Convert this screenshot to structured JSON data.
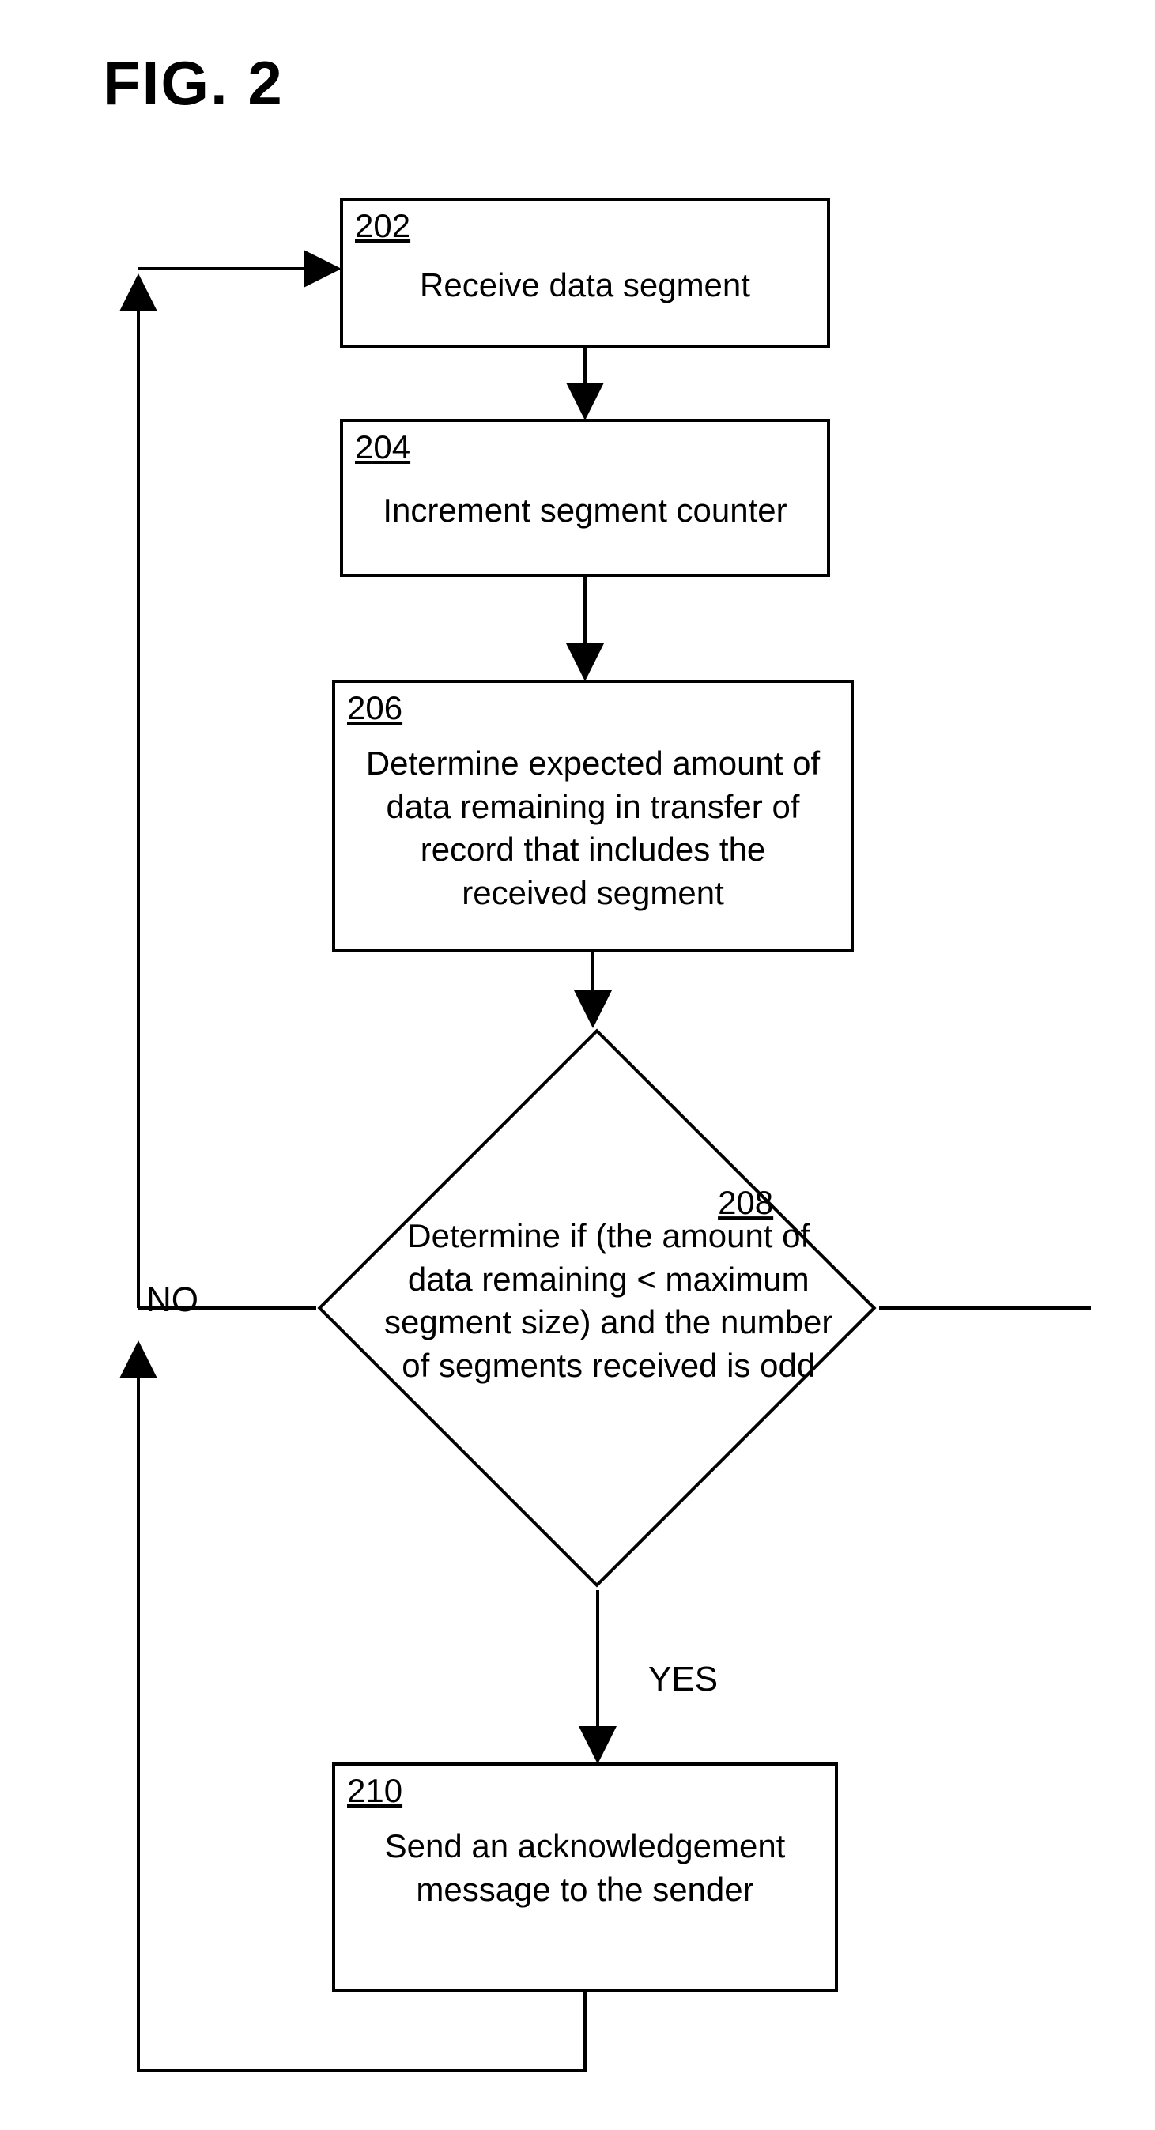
{
  "title": "FIG. 2",
  "nodes": {
    "n202": {
      "num": "202",
      "text": "Receive data segment"
    },
    "n204": {
      "num": "204",
      "text": "Increment segment counter"
    },
    "n206": {
      "num": "206",
      "text": "Determine expected amount of data remaining in transfer of record that includes the received segment"
    },
    "n208": {
      "num": "208",
      "text": "Determine if (the amount of data remaining <  maximum segment size) and  the number of segments received is odd"
    },
    "n210": {
      "num": "210",
      "text": "Send an acknowledgement message to the sender"
    }
  },
  "labels": {
    "no": "NO",
    "yes": "YES"
  },
  "chart_data": {
    "type": "flowchart",
    "nodes": [
      {
        "id": "202",
        "shape": "rect",
        "label": "Receive data segment"
      },
      {
        "id": "204",
        "shape": "rect",
        "label": "Increment segment counter"
      },
      {
        "id": "206",
        "shape": "rect",
        "label": "Determine expected amount of data remaining in transfer of record that includes the received segment"
      },
      {
        "id": "208",
        "shape": "diamond",
        "label": "Determine if (the amount of data remaining < maximum segment size) and the number of segments received is odd"
      },
      {
        "id": "210",
        "shape": "rect",
        "label": "Send an acknowledgement message to the sender"
      }
    ],
    "edges": [
      {
        "from": "202",
        "to": "204"
      },
      {
        "from": "204",
        "to": "206"
      },
      {
        "from": "206",
        "to": "208"
      },
      {
        "from": "208",
        "to": "210",
        "label": "YES"
      },
      {
        "from": "208",
        "to": "202",
        "label": "NO"
      },
      {
        "from": "210",
        "to": "202"
      }
    ]
  }
}
